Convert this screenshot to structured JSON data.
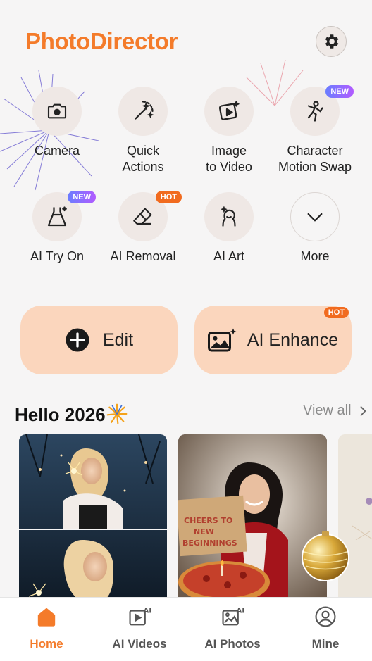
{
  "app": {
    "title": "PhotoDirector"
  },
  "header": {
    "settings_icon": "gear-icon"
  },
  "tools": [
    {
      "label": "Camera",
      "icon": "camera-icon",
      "badge": ""
    },
    {
      "label": "Quick\nActions",
      "icon": "magic-wand-icon",
      "badge": ""
    },
    {
      "label": "Image\nto Video",
      "icon": "image-to-video-icon",
      "badge": ""
    },
    {
      "label": "Character\nMotion Swap",
      "icon": "dancing-figure-icon",
      "badge": "NEW"
    },
    {
      "label": "AI Try On",
      "icon": "dress-icon",
      "badge": "NEW"
    },
    {
      "label": "AI Removal",
      "icon": "eraser-icon",
      "badge": "HOT"
    },
    {
      "label": "AI Art",
      "icon": "portrait-sparkle-icon",
      "badge": ""
    },
    {
      "label": "More",
      "icon": "chevron-down-icon",
      "badge": ""
    }
  ],
  "actions": {
    "edit_label": "Edit",
    "enhance_label": "AI Enhance",
    "enhance_badge": "HOT"
  },
  "section": {
    "title": "Hello 2026",
    "view_all": "View all"
  },
  "cards": {
    "pizza_box_text": "CHEERS TO\nNEW\nBEGINNINGS"
  },
  "nav": [
    {
      "label": "Home",
      "icon": "home-icon",
      "active": true
    },
    {
      "label": "AI Videos",
      "icon": "ai-video-icon",
      "active": false
    },
    {
      "label": "AI Photos",
      "icon": "ai-photo-icon",
      "active": false
    },
    {
      "label": "Mine",
      "icon": "profile-icon",
      "active": false
    }
  ],
  "colors": {
    "brand": "#f47b2a",
    "button_bg": "#fbd6bd",
    "hot": "#f16b1f"
  }
}
